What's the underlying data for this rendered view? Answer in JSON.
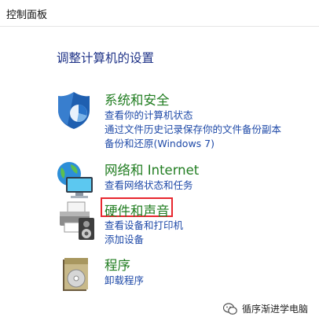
{
  "window": {
    "title": "控制面板"
  },
  "heading": "调整计算机的设置",
  "categories": [
    {
      "name": "系统和安全",
      "icon": "shield-icon",
      "links": [
        "查看你的计算机状态",
        "通过文件历史记录保存你的文件备份副本",
        "备份和还原(Windows 7)"
      ]
    },
    {
      "name": "网络和 Internet",
      "icon": "network-globe-icon",
      "links": [
        "查看网络状态和任务"
      ]
    },
    {
      "name": "硬件和声音",
      "icon": "printer-speaker-icon",
      "highlighted": true,
      "highlight_color": "#e8272f",
      "links": [
        "查看设备和打印机",
        "添加设备"
      ]
    },
    {
      "name": "程序",
      "icon": "programs-box-icon",
      "links": [
        "卸载程序"
      ]
    }
  ],
  "watermark": {
    "text": "循序渐进学电脑",
    "icon": "wechat-icon"
  },
  "colors": {
    "category": "#217d21",
    "link": "#1f4aa8",
    "heading": "#1e3287"
  }
}
